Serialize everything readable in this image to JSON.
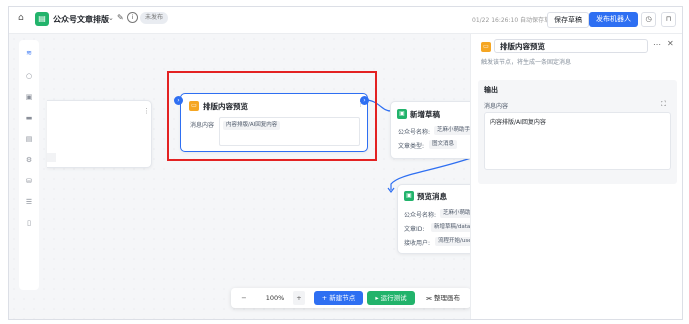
{
  "topbar": {
    "app_title": "公众号文章排版",
    "status_badge": "未发布",
    "save_status": "01/22 16:26:10 自动保存草稿",
    "save_label": "保存草稿",
    "publish_label": "发布机器人"
  },
  "nodes": {
    "preview": {
      "title": "排版内容预览",
      "field_label": "消息内容",
      "field_value": "内容排版/AI回复内容"
    },
    "draft": {
      "title": "新增草稿",
      "rows": [
        {
          "label": "公众号名称:",
          "value": "芝麻小萌助手"
        },
        {
          "label": "文章类型:",
          "value": "图文消息"
        }
      ]
    },
    "send": {
      "title": "预览消息",
      "rows": [
        {
          "label": "公众号名称:",
          "value": "芝麻小萌助手"
        },
        {
          "label": "文章ID:",
          "value": "新增草稿/data/m"
        },
        {
          "label": "接收用户:",
          "value": "流程开始/user"
        }
      ]
    }
  },
  "panel": {
    "title": "排版内容预览",
    "description": "触发该节点，将生成一条固定消息",
    "section_title": "输出",
    "field_label": "消息内容",
    "field_value": "内容排版/AI回复内容"
  },
  "bottom_toolbar": {
    "zoom_out": "−",
    "zoom": "100%",
    "zoom_in": "+",
    "add_node": "+ 新建节点",
    "run_test": "▸ 运行测试",
    "arrange": "⫘ 整理画布"
  },
  "colors": {
    "accent": "#2e6ff2",
    "green": "#22b36b",
    "highlight": "#e32222",
    "node_orange": "#f5a623"
  }
}
